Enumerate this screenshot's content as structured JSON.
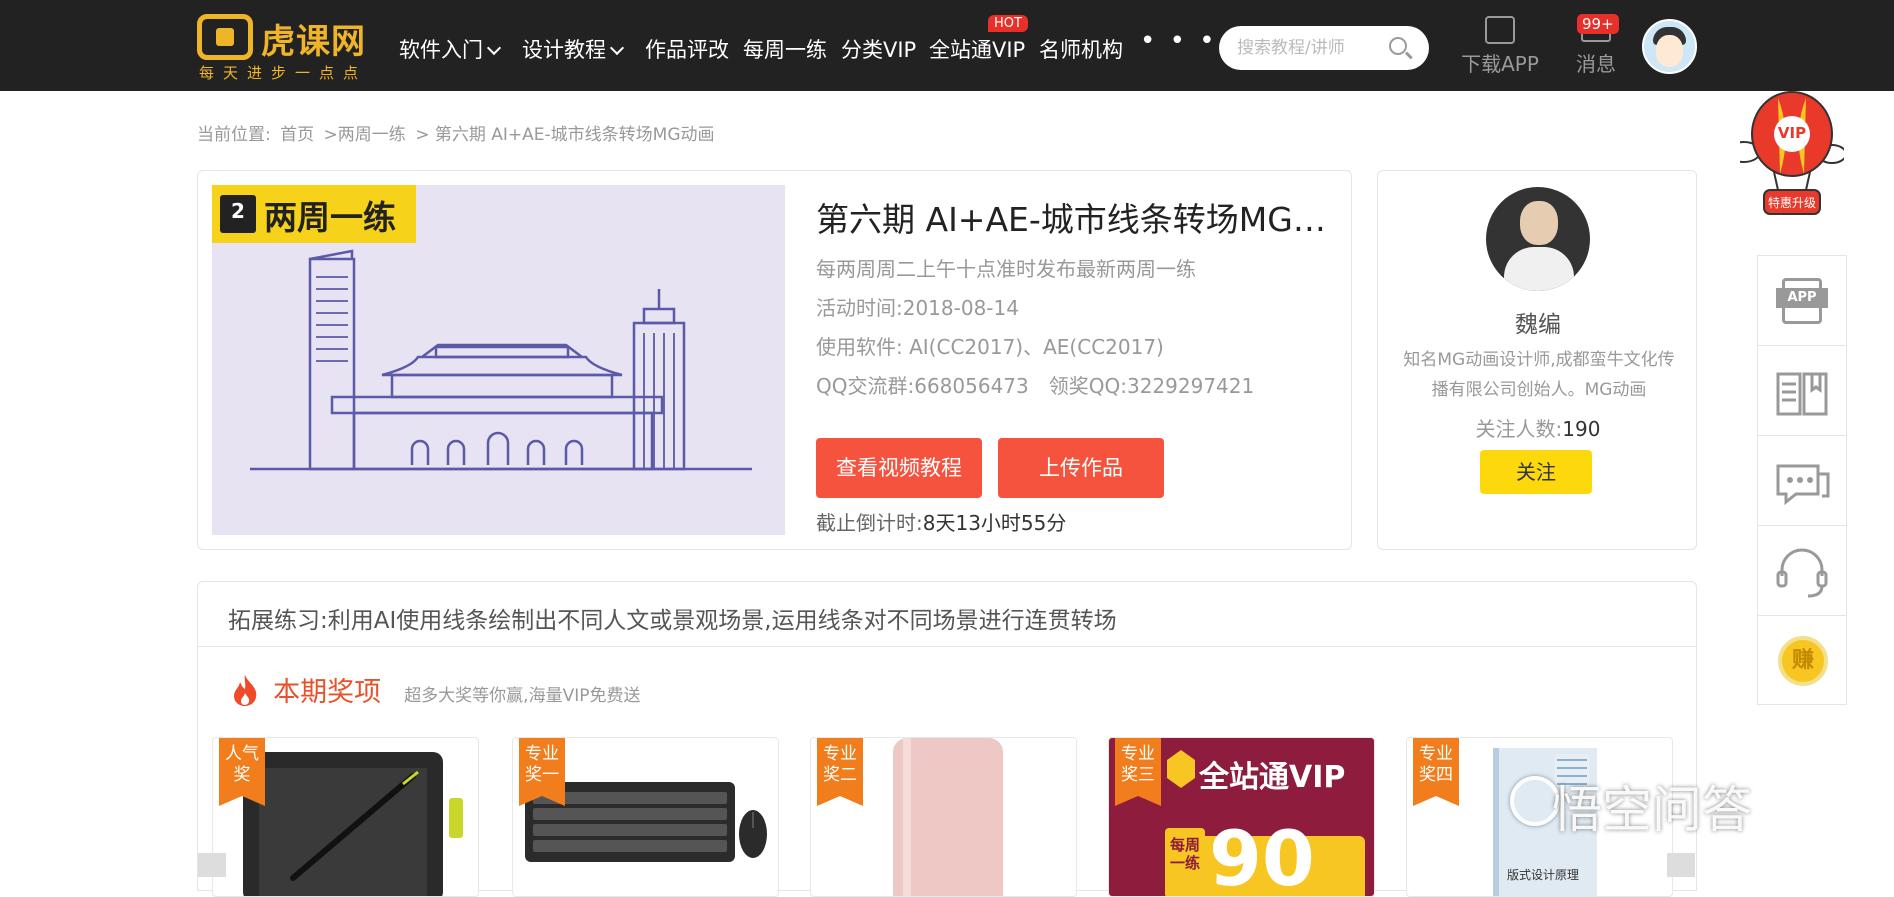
{
  "header": {
    "logo_name": "虎课网",
    "logo_slogan": "每天进步一点点",
    "nav": [
      {
        "label": "软件入门",
        "dropdown": true
      },
      {
        "label": "设计教程",
        "dropdown": true
      },
      {
        "label": "作品评改"
      },
      {
        "label": "每周一练"
      },
      {
        "label": "分类VIP"
      },
      {
        "label": "全站通VIP",
        "badge": "HOT"
      },
      {
        "label": "名师机构"
      }
    ],
    "more_label": "• • •",
    "search_placeholder": "搜索教程/讲师",
    "download_app": "下载APP",
    "messages_label": "消息",
    "messages_badge": "99+"
  },
  "breadcrumb": {
    "prefix": "当前位置:",
    "home": "首页",
    "section": ">两周一练",
    "current": "> 第六期 AI+AE-城市线条转场MG动画"
  },
  "course": {
    "cover_tag": "两周一练",
    "cover_weeks": "2",
    "title": "第六期 AI+AE-城市线条转场MG动画",
    "schedule": "每两周周二上午十点准时发布最新两周一练",
    "activity_time": "活动时间:2018-08-14",
    "software": "使用软件: AI(CC2017)、AE(CC2017)",
    "qq": "QQ交流群:668056473　领奖QQ:3229297421",
    "btn_watch": "查看视频教程",
    "btn_upload": "上传作品",
    "countdown_label": "截止倒计时:",
    "countdown_value": "8天13小时55分"
  },
  "author": {
    "name": "魏编",
    "bio": "知名MG动画设计师,成都蛮牛文化传播有限公司创始人。MG动画",
    "followers_label": "关注人数:",
    "followers_value": "190",
    "follow_btn": "关注"
  },
  "extend": {
    "text": "拓展练习:利用AI使用线条绘制出不同人文或景观场景,运用线条对不同场景进行连贯转场"
  },
  "prizes": {
    "title": "本期奖项",
    "subtitle": "超多大奖等你赢,海量VIP免费送",
    "items": [
      {
        "ribbon": "人气奖",
        "item": "drawing-tablet"
      },
      {
        "ribbon": "专业奖一",
        "item": "keyboard-mouse"
      },
      {
        "ribbon": "专业奖二",
        "item": "power-bank"
      },
      {
        "ribbon": "专业奖三",
        "item": "vip-card",
        "vip_text": "全站通VIP",
        "vip_days": "90",
        "vip_side": "每周一练"
      },
      {
        "ribbon": "专业奖四",
        "item": "book",
        "book_text": "版式设计原理"
      }
    ]
  },
  "side": {
    "vip_label": "VIP",
    "vip_sub": "特惠升级",
    "app_label": "APP",
    "earn_label": "赚"
  },
  "watermark": "悟空问答",
  "colors": {
    "accent": "#f5533d",
    "brand": "#f0b428",
    "follow": "#fcd80c",
    "hot": "#e8302a"
  }
}
